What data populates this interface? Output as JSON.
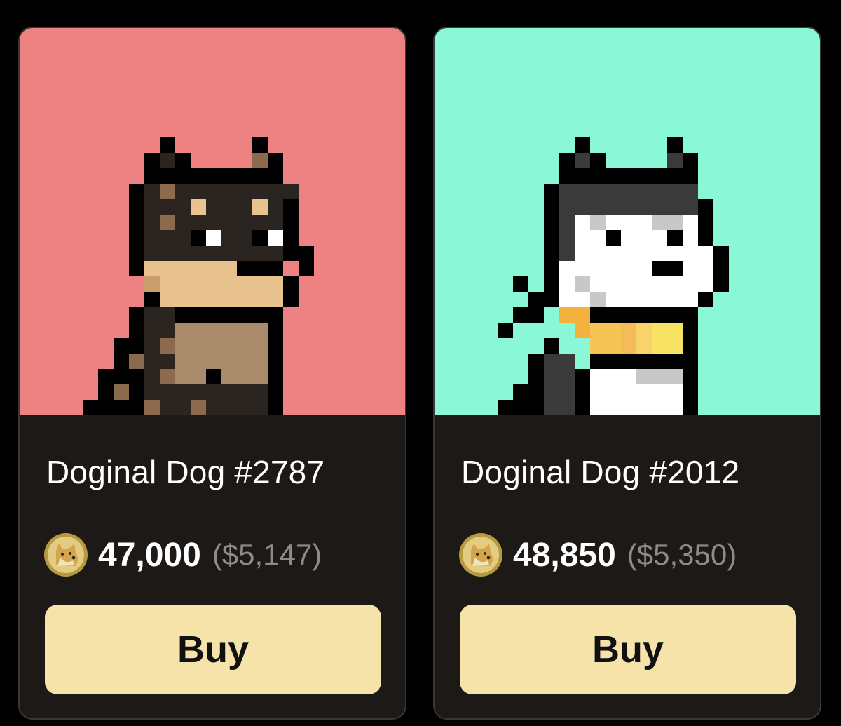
{
  "colors": {
    "page_bg": "#000000",
    "card_bg": "#1c1917",
    "button_bg": "#f6e3a9",
    "price_muted": "#8f8b88"
  },
  "cards": [
    {
      "title": "Doginal Dog #2787",
      "price_doge": "47,000",
      "price_usd": "($5,147)",
      "buy_label": "Buy",
      "art_bg": "#ee8283",
      "coin_icon": "dogecoin-icon",
      "art_icon": "pixel-dog-doberman-icon"
    },
    {
      "title": "Doginal Dog #2012",
      "price_doge": "48,850",
      "price_usd": "($5,350)",
      "buy_label": "Buy",
      "art_bg": "#8af8d6",
      "coin_icon": "dogecoin-icon",
      "art_icon": "pixel-dog-husky-icon"
    }
  ]
}
